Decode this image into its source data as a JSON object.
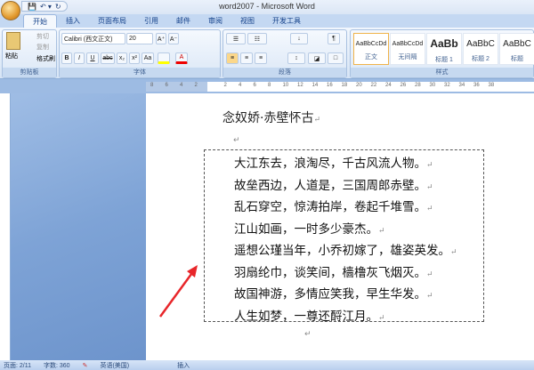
{
  "window": {
    "title": "word2007 - Microsoft Word"
  },
  "qat": {
    "save": "💾",
    "undo": "↶ ▾",
    "redo": "↻"
  },
  "tabs": [
    "开始",
    "插入",
    "页面布局",
    "引用",
    "邮件",
    "审阅",
    "视图",
    "开发工具"
  ],
  "clipboard": {
    "paste": "粘贴",
    "cut": "剪切",
    "copy": "复制",
    "format_painter": "格式刷",
    "label": "剪贴板"
  },
  "font": {
    "name": "Calibri (西文正文)",
    "size": "20",
    "label": "字体",
    "bold": "B",
    "italic": "I",
    "underline": "U",
    "strike": "abc",
    "sub": "x₂",
    "sup": "x²",
    "case": "Aa",
    "grow": "A⁺",
    "shrink": "A⁻",
    "color": "A"
  },
  "paragraph": {
    "label": "段落"
  },
  "styles": {
    "label": "样式",
    "items": [
      {
        "sample": "AaBbCcDd",
        "name": "正文"
      },
      {
        "sample": "AaBbCcDd",
        "name": "无间隔"
      },
      {
        "sample": "AaBb",
        "name": "标题 1"
      },
      {
        "sample": "AaBbC",
        "name": "标题 2"
      },
      {
        "sample": "AaBbC",
        "name": "标题"
      }
    ]
  },
  "ruler": {
    "ticks": [
      "8",
      "6",
      "4",
      "2",
      "",
      "2",
      "4",
      "6",
      "8",
      "10",
      "12",
      "14",
      "16",
      "18",
      "20",
      "22",
      "24",
      "26",
      "28",
      "30",
      "32",
      "34",
      "36",
      "38"
    ]
  },
  "document": {
    "title": "念奴娇·赤壁怀古",
    "paragraph_mark": "↵",
    "lines": [
      "大江东去，浪淘尽，千古风流人物。",
      "故垒西边，人道是，三国周郎赤壁。",
      "乱石穿空，惊涛拍岸，卷起千堆雪。",
      "江山如画，一时多少豪杰。",
      "遥想公瑾当年，小乔初嫁了，雄姿英发。",
      "羽扇纶巾，谈笑间，樯橹灰飞烟灭。",
      "故国神游，多情应笑我，早生华发。",
      "人生如梦，一尊还酹江月。"
    ]
  },
  "annotation": {
    "arrow_color": "#e8262a"
  },
  "status": {
    "page": "页面: 2/11",
    "words": "字数: 360",
    "language": "英语(美国)",
    "mode": "插入"
  }
}
